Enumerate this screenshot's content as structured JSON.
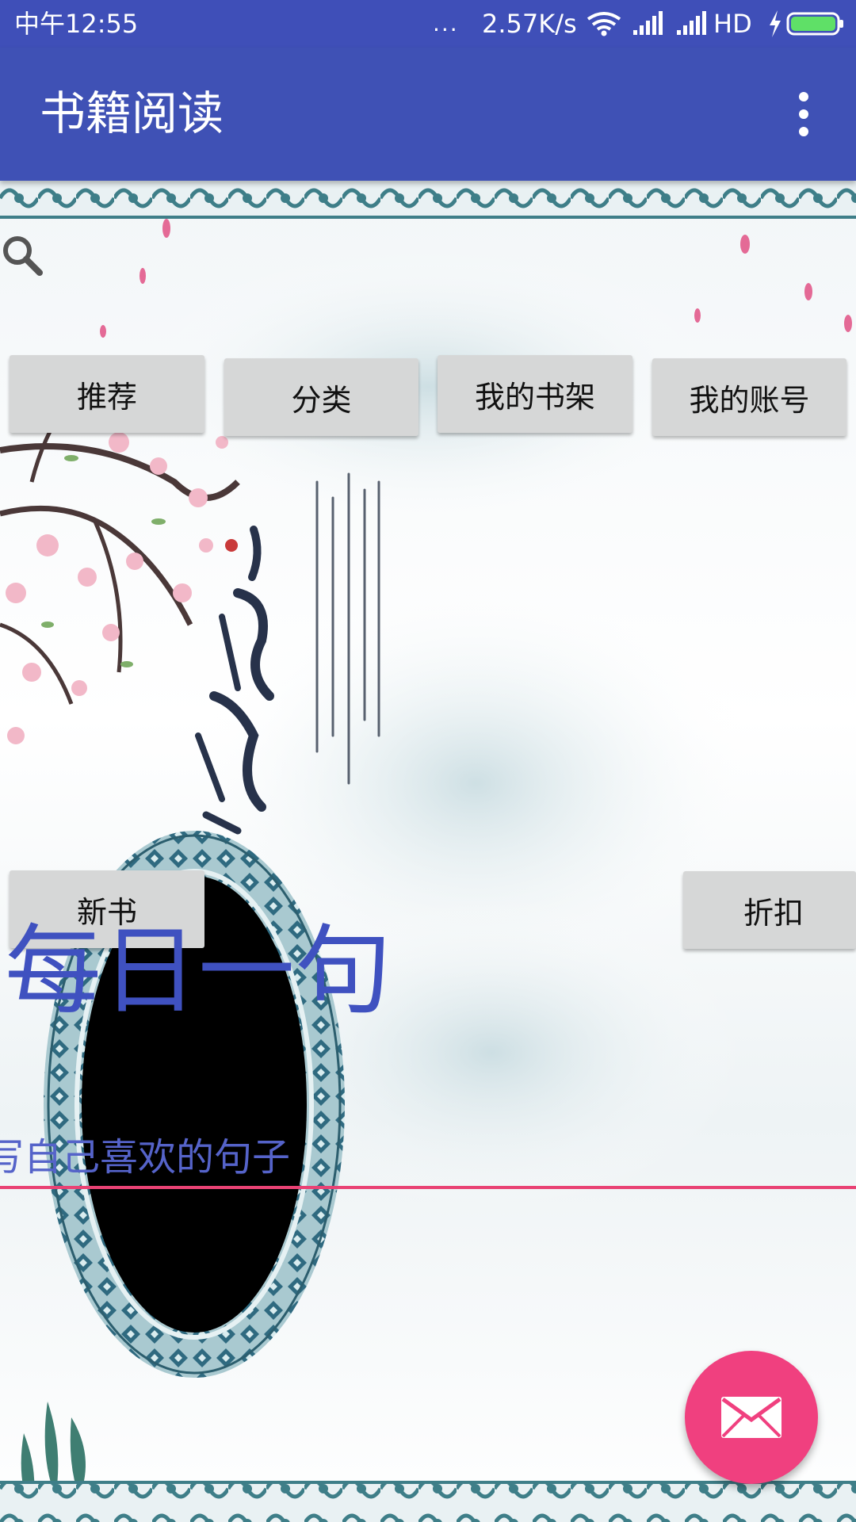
{
  "status_bar": {
    "time": "中午12:55",
    "dots": "...",
    "speed": "2.57K/s",
    "network": "HD"
  },
  "app_bar": {
    "title": "书籍阅读"
  },
  "buttons": {
    "recommend": "推荐",
    "category": "分类",
    "bookshelf": "我的书架",
    "account": "我的账号",
    "new_books": "新书",
    "discount": "折扣"
  },
  "daily": {
    "title": "每日一句",
    "placeholder": "写自己喜欢的句子"
  },
  "colors": {
    "primary": "#3F51B5",
    "status_bar": "#3F4FB8",
    "accent": "#F0407F",
    "button_bg": "#D6D7D7",
    "daily_text": "#3F51C0"
  },
  "icons": {
    "search": "search-icon",
    "overflow": "overflow-menu-icon",
    "fab": "mail-icon"
  }
}
